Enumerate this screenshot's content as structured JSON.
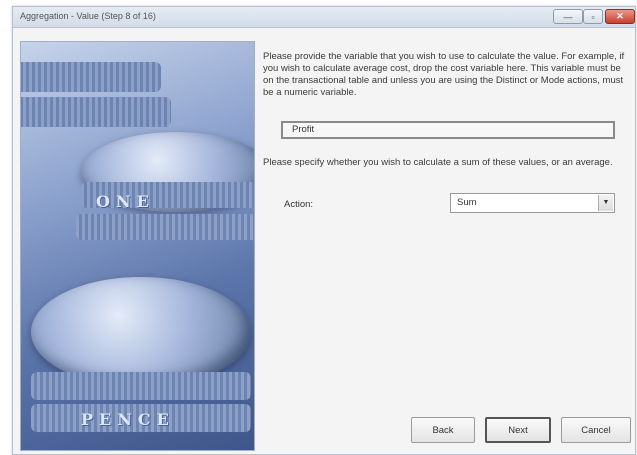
{
  "window": {
    "title": "Aggregation - Value (Step 8 of 16)",
    "controls": {
      "minimize": "—",
      "maximize": "▫",
      "close": "✕"
    }
  },
  "main": {
    "instruction_variable": "Please provide the variable that you wish to use to calculate the value. For example, if you wish to calculate average cost, drop the cost variable here. This variable must be on the transactional table and unless you are using the Distinct or Mode actions, must be a numeric variable.",
    "variable_value": "Profit",
    "instruction_action": "Please specify whether you wish to calculate a sum of these values, or an average.",
    "action_label": "Action:",
    "action_selected": "Sum"
  },
  "buttons": {
    "back": "Back",
    "next": "Next",
    "cancel": "Cancel"
  },
  "image": {
    "engraving_1": "ONE",
    "engraving_2": "PENCE"
  }
}
